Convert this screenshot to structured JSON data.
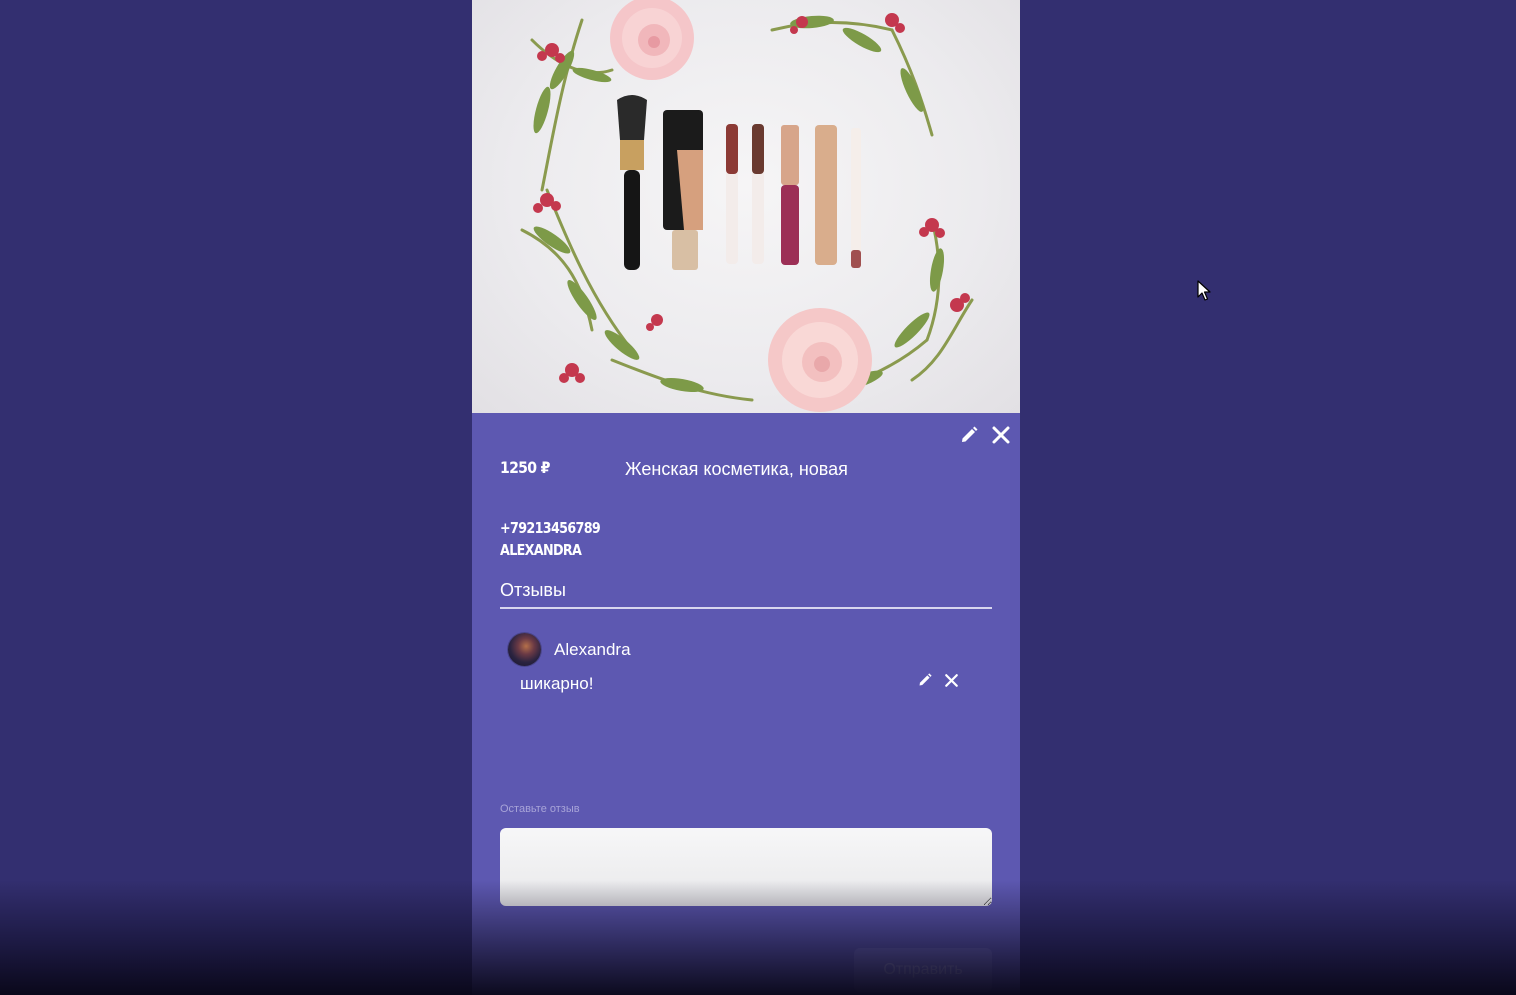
{
  "ad": {
    "price": "1250 ₽",
    "title": "Женская косметика, новая",
    "phone": "+79213456789",
    "seller_name": "ALEXANDRA",
    "image_alt": "Косметика и цветы"
  },
  "actions": {
    "edit_icon": "pencil-icon",
    "close_icon": "close-icon"
  },
  "reviews": {
    "heading": "Отзывы",
    "items": [
      {
        "author": "Alexandra",
        "text": "шикарно!"
      }
    ]
  },
  "review_form": {
    "label": "Оставьте отзыв",
    "value": "",
    "submit_label": "Отправить"
  },
  "colors": {
    "background": "#332f70",
    "card": "#5d58b1",
    "accent_text": "#ffffff"
  }
}
